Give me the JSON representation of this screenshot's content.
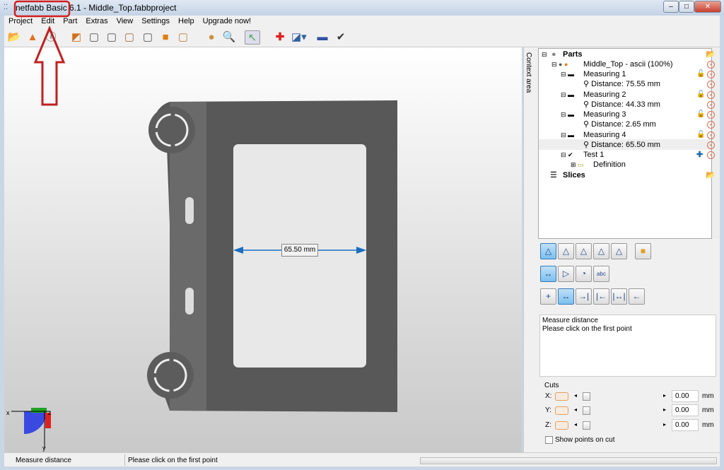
{
  "window": {
    "title": "netfabb Basic 6.1 - Middle_Top.fabbproject",
    "min": "‒",
    "max": "□",
    "close": "✕"
  },
  "menu": [
    "Project",
    "Edit",
    "Part",
    "Extras",
    "View",
    "Settings",
    "Help",
    "Upgrade now!"
  ],
  "viewport": {
    "measurement_label": "65.50 mm",
    "axis_x": "x",
    "axis_y": "y",
    "axis_z": "z"
  },
  "context_tab": "Context area",
  "tree": {
    "parts": "Parts",
    "part": "Middle_Top - ascii (100%)",
    "measurings": [
      {
        "name": "Measuring 1",
        "distance": "Distance: 75.55 mm"
      },
      {
        "name": "Measuring 2",
        "distance": "Distance: 44.33 mm"
      },
      {
        "name": "Measuring 3",
        "distance": "Distance: 2.65 mm"
      },
      {
        "name": "Measuring 4",
        "distance": "Distance: 65.50 mm"
      }
    ],
    "test": "Test 1",
    "definition": "Definition",
    "slices": "Slices"
  },
  "info": {
    "line1": "Measure distance",
    "line2": "Please click on the first point"
  },
  "cuts": {
    "title": "Cuts",
    "axes": [
      {
        "label": "X:",
        "value": "0.00",
        "unit": "mm"
      },
      {
        "label": "Y:",
        "value": "0.00",
        "unit": "mm"
      },
      {
        "label": "Z:",
        "value": "0.00",
        "unit": "mm"
      }
    ],
    "show_points": "Show points on cut"
  },
  "status": {
    "left": "Measure distance",
    "right": "Please click on the first point"
  }
}
